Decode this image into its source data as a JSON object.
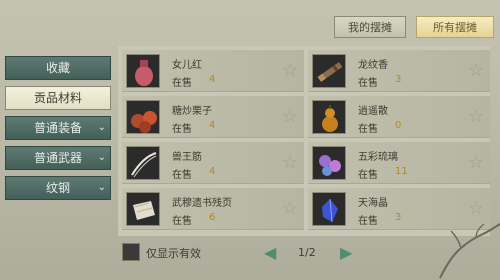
{
  "tabs": {
    "mine": "我的摆摊",
    "all": "所有摆摊"
  },
  "sidebar": {
    "items": [
      {
        "label": "收藏"
      },
      {
        "label": "贡品材料"
      },
      {
        "label": "普通装备"
      },
      {
        "label": "普通武器"
      },
      {
        "label": "纹钢"
      }
    ]
  },
  "items": [
    {
      "name": "女儿红",
      "status": "在售",
      "count": "4",
      "icon": "wine-jar-icon"
    },
    {
      "name": "龙纹香",
      "status": "在售",
      "count": "3",
      "icon": "incense-bundle-icon"
    },
    {
      "name": "糖炒栗子",
      "status": "在售",
      "count": "4",
      "icon": "chestnut-icon"
    },
    {
      "name": "逍遥散",
      "status": "在售",
      "count": "0",
      "icon": "gourd-icon"
    },
    {
      "name": "兽王筋",
      "status": "在售",
      "count": "4",
      "icon": "tendon-icon"
    },
    {
      "name": "五彩琉璃",
      "status": "在售",
      "count": "11",
      "icon": "glass-beads-icon"
    },
    {
      "name": "武穆遗书残页",
      "status": "在售",
      "count": "6",
      "icon": "paper-scroll-icon"
    },
    {
      "name": "天海晶",
      "status": "在售",
      "count": "3",
      "icon": "blue-crystal-icon"
    }
  ],
  "filter": {
    "label": "仅显示有效"
  },
  "pagination": {
    "text": "1/2"
  }
}
